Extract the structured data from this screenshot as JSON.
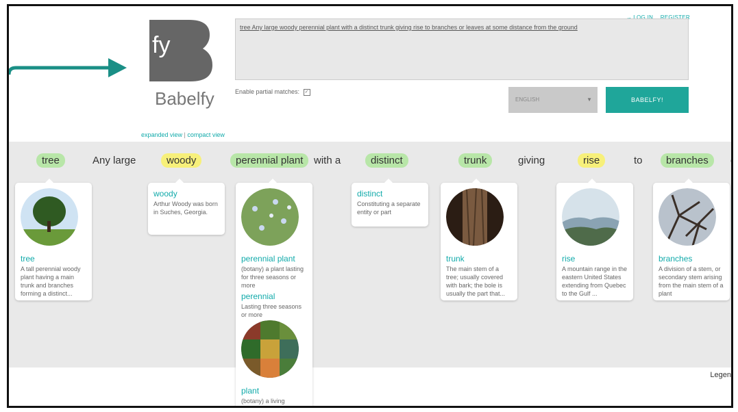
{
  "header": {
    "login": "LOG IN",
    "register": "REGISTER",
    "logo_text": "Babelfy"
  },
  "input": {
    "text": "tree Any large woody perennial plant with a distinct trunk giving rise to branches or leaves at some distance from the ground",
    "partial_label": "Enable partial matches:",
    "partial_checked": true,
    "language": "ENGLISH",
    "submit": "BABELFY!"
  },
  "views": {
    "expanded": "expanded view",
    "separator": " | ",
    "compact": "compact view"
  },
  "sentence": [
    {
      "text": "tree",
      "highlight": "green"
    },
    {
      "text": "Any large",
      "highlight": "none"
    },
    {
      "text": "woody",
      "highlight": "yellow"
    },
    {
      "text": "perennial plant",
      "highlight": "green"
    },
    {
      "text": "with a",
      "highlight": "none"
    },
    {
      "text": "distinct",
      "highlight": "green"
    },
    {
      "text": "trunk",
      "highlight": "green"
    },
    {
      "text": "giving",
      "highlight": "none"
    },
    {
      "text": "rise",
      "highlight": "yellow"
    },
    {
      "text": "to",
      "highlight": "none"
    },
    {
      "text": "branches",
      "highlight": "green"
    },
    {
      "text": "o",
      "highlight": "none"
    }
  ],
  "cards": {
    "tree": {
      "title": "tree",
      "desc": "A tall perennial woody plant having a main trunk and branches forming a distinct..."
    },
    "woody": {
      "title": "woody",
      "desc": "Arthur Woody was born in Suches, Georgia."
    },
    "perennial_plant": {
      "title": "perennial plant",
      "desc": "(botany) a plant lasting for three seasons or more"
    },
    "perennial": {
      "title": "perennial",
      "desc": "Lasting three seasons or more"
    },
    "plant": {
      "title": "plant",
      "desc": "(botany) a living organism lacking the"
    },
    "distinct": {
      "title": "distinct",
      "desc": "Constituting a separate entity or part"
    },
    "trunk": {
      "title": "trunk",
      "desc": "The main stem of a tree; usually covered with bark; the bole is usually the part that..."
    },
    "rise": {
      "title": "rise",
      "desc": "A mountain range in the eastern United States extending from Quebec to the Gulf ..."
    },
    "branches": {
      "title": "branches",
      "desc": "A division of a stem, or secondary stem arising from the main stem of a plant"
    }
  },
  "legend": "Legen",
  "colors": {
    "accent": "#1fa69a",
    "green_hl": "#b8e6a8",
    "yellow_hl": "#f7f07a"
  }
}
